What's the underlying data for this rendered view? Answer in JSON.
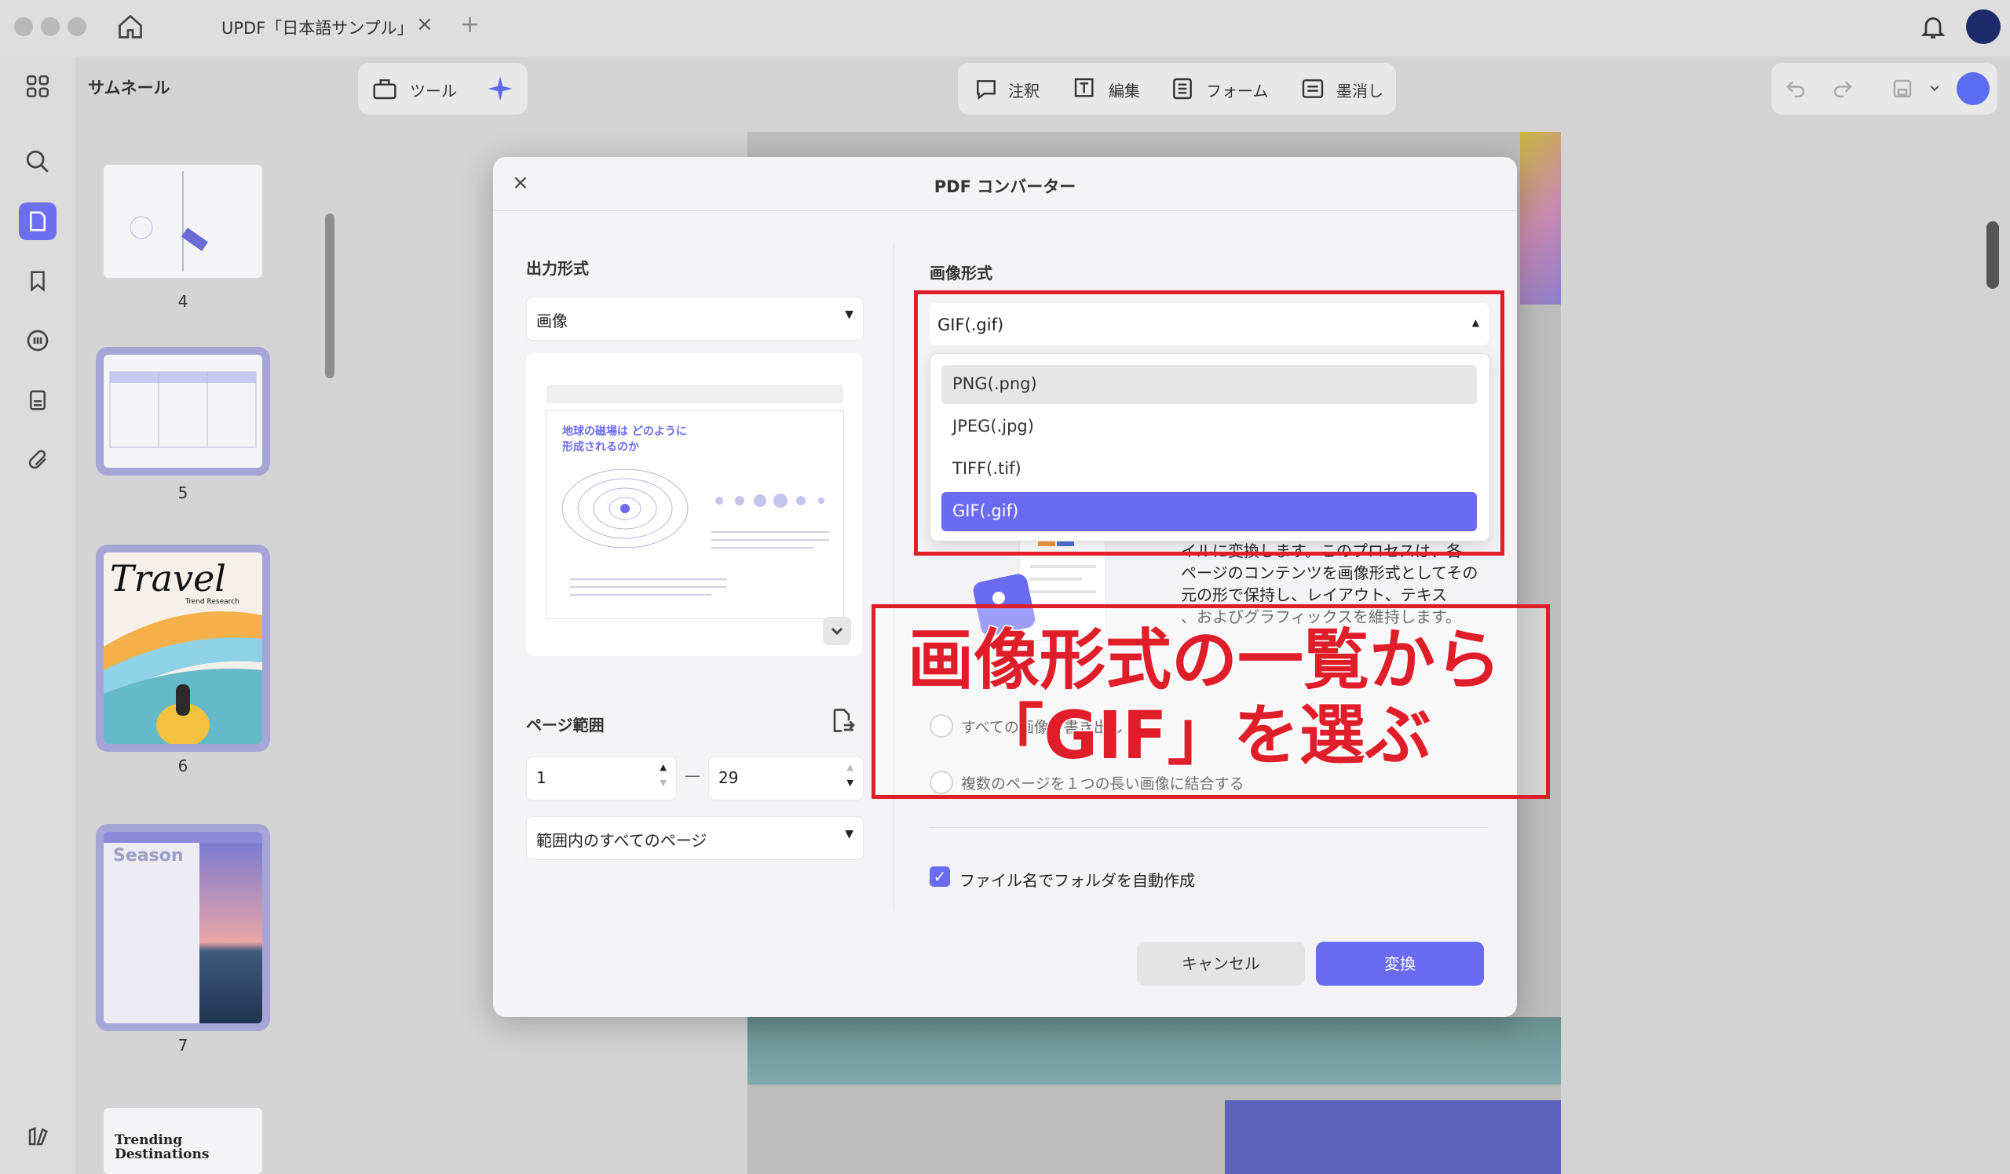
{
  "titlebar": {
    "tab_title": "UPDF「日本語サンプル」",
    "tab_close": "×",
    "tab_add": "+"
  },
  "sidebar": {
    "title": "サムネール",
    "pages": [
      "4",
      "5",
      "6",
      "7"
    ],
    "thumb6_text": "Travel",
    "thumb6_sub": "Trend Research",
    "thumb7_text": "Season",
    "thumb8_text": "Trending Destinations"
  },
  "toolbar": {
    "tools_label": "ツール",
    "comment_label": "注釈",
    "edit_label": "編集",
    "form_label": "フォーム",
    "redact_label": "墨消し"
  },
  "dialog": {
    "title": "PDF コンバーター",
    "close": "×",
    "output_format_label": "出力形式",
    "output_format_value": "画像",
    "preview_heading": "地球の磁場は どのように形成されるのか",
    "page_range_label": "ページ範囲",
    "range_from": "1",
    "range_to": "29",
    "range_dash": "—",
    "range_option": "範囲内のすべてのページ",
    "image_format_label": "画像形式",
    "image_format_value": "GIF(.gif)",
    "image_format_options": [
      "PNG(.png)",
      "JPEG(.jpg)",
      "TIFF(.tif)",
      "GIF(.gif)"
    ],
    "description_lines": [
      "イルに変換します。このプロセスは、各",
      "ページのコンテンツを画像形式としてその",
      "元の形で保持し、レイアウト、テキス",
      "、およびグラフィックスを維持します。"
    ],
    "radio1": "すべての画像を書き出し",
    "radio2": "複数のページを１つの長い画像に結合する",
    "auto_folder": "ファイル名でフォルダを自動作成",
    "cancel": "キャンセル",
    "convert": "変換"
  },
  "annotation": {
    "line1": "画像形式の一覧から",
    "line2": "「GIF」を選ぶ",
    "color": "#e01e2a"
  },
  "colors": {
    "accent": "#6a6af2",
    "annotation_red": "#e01e2a"
  }
}
